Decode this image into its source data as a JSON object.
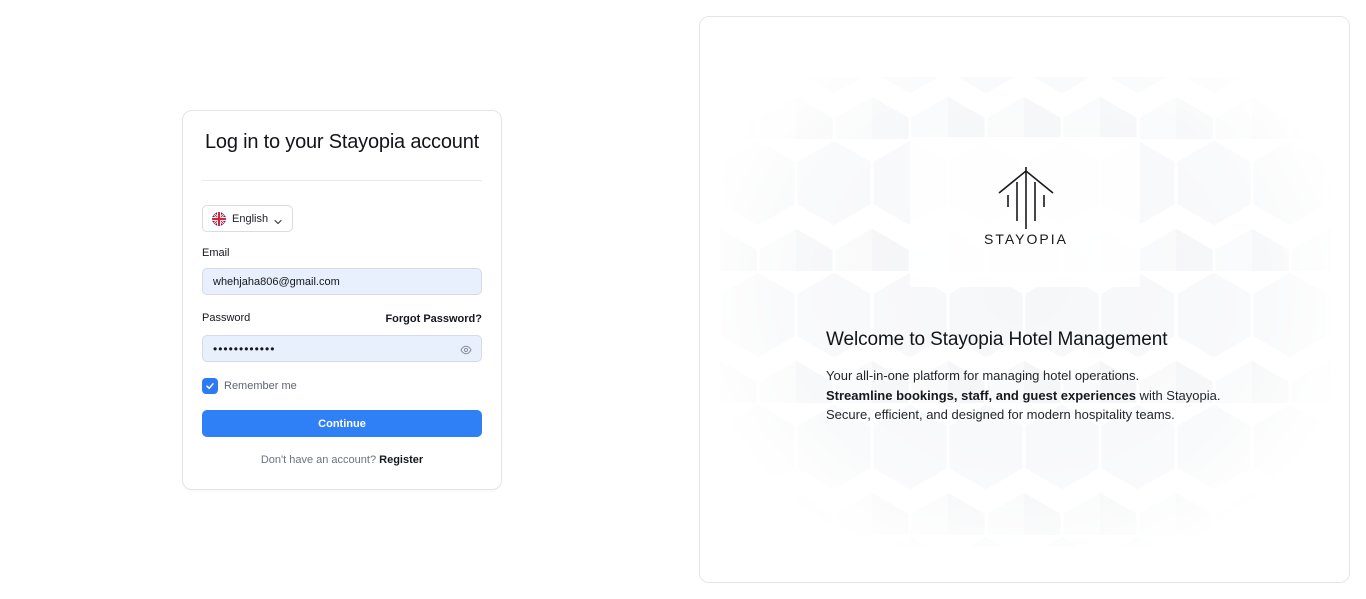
{
  "login": {
    "title": "Log in to your Stayopia account",
    "language": {
      "selected": "English",
      "flag_icon": "uk-flag-icon",
      "chevron_icon": "chevron-down-icon"
    },
    "email": {
      "label": "Email",
      "value": "whehjaha806@gmail.com"
    },
    "password": {
      "label": "Password",
      "value": "••••••••••••",
      "forgot_label": "Forgot Password?",
      "toggle_icon": "eye-icon"
    },
    "remember": {
      "label": "Remember me",
      "checked": true
    },
    "continue_label": "Continue",
    "register_prompt": "Don't have an account?",
    "register_label": "Register"
  },
  "welcome": {
    "logo_text": "STAYOPIA",
    "title": "Welcome to Stayopia Hotel Management",
    "line1": "Your all-in-one platform for managing hotel operations.",
    "line2_bold": "Streamline bookings, staff, and guest experiences",
    "line2_rest": " with Stayopia.",
    "line3": "Secure, efficient, and designed for modern hospitality teams."
  },
  "colors": {
    "accent": "#2f80f7",
    "input_bg": "#e8effd",
    "border": "#e3e5e8"
  }
}
